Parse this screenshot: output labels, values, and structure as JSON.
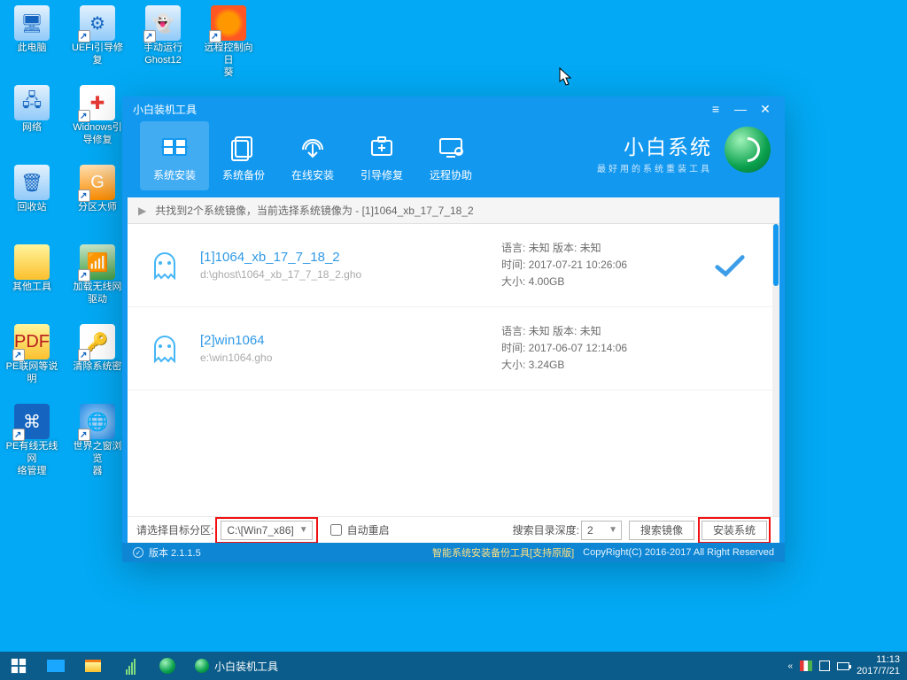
{
  "desktop": {
    "cols": [
      [
        {
          "id": "mycomputer",
          "label": "此电脑",
          "glyph": "mycomputer",
          "shortcut": false
        },
        {
          "id": "network",
          "label": "网络",
          "glyph": "network",
          "shortcut": false
        },
        {
          "id": "recyclebin",
          "label": "回收站",
          "glyph": "bin",
          "shortcut": false
        },
        {
          "id": "othertools",
          "label": "其他工具",
          "glyph": "folder",
          "shortcut": false
        },
        {
          "id": "pdfhelp",
          "label": "PE联网等说明",
          "glyph": "pdf",
          "shortcut": true
        },
        {
          "id": "lan",
          "label": "PE有线无线网\n络管理",
          "glyph": "lan",
          "shortcut": true
        }
      ],
      [
        {
          "id": "uefi",
          "label": "UEFI引导修复",
          "glyph": "uefi",
          "shortcut": true
        },
        {
          "id": "winboot",
          "label": "Widnows引\n导修复",
          "glyph": "firstaid",
          "shortcut": true
        },
        {
          "id": "diskmaster",
          "label": "分区大师",
          "glyph": "disk",
          "shortcut": true
        },
        {
          "id": "wifidriver",
          "label": "加载无线网\n驱动",
          "glyph": "antenna",
          "shortcut": true
        },
        {
          "id": "clearpwd",
          "label": "清除系统密",
          "glyph": "key",
          "shortcut": true
        },
        {
          "id": "browser",
          "label": "世界之窗浏览\n器",
          "glyph": "globe",
          "shortcut": true
        }
      ],
      [
        {
          "id": "ghost",
          "label": "手动运行\nGhost12",
          "glyph": "ghost",
          "shortcut": true
        }
      ],
      [
        {
          "id": "sunflower",
          "label": "远程控制向日\n葵",
          "glyph": "sunflower",
          "shortcut": true
        }
      ]
    ]
  },
  "window": {
    "title": "小白装机工具",
    "brand_primary": "小白系统",
    "brand_secondary": "最好用的系统重装工具",
    "tabs": [
      {
        "id": "install",
        "label": "系统安装",
        "active": true
      },
      {
        "id": "backup",
        "label": "系统备份",
        "active": false
      },
      {
        "id": "online",
        "label": "在线安装",
        "active": false
      },
      {
        "id": "bootfix",
        "label": "引导修复",
        "active": false
      },
      {
        "id": "remote",
        "label": "远程协助",
        "active": false
      }
    ],
    "infobar": "共找到2个系统镜像，当前选择系统镜像为 - [1]1064_xb_17_7_18_2",
    "items": [
      {
        "title": "[1]1064_xb_17_7_18_2",
        "path": "d:\\ghost\\1064_xb_17_7_18_2.gho",
        "lang": "语言: 未知    版本: 未知",
        "time": "时间: 2017-07-21 10:26:06",
        "size": "大小: 4.00GB",
        "selected": true
      },
      {
        "title": "[2]win1064",
        "path": "e:\\win1064.gho",
        "lang": "语言: 未知    版本: 未知",
        "time": "时间: 2017-06-07 12:14:06",
        "size": "大小: 3.24GB",
        "selected": false
      }
    ],
    "bottom": {
      "partition_label": "请选择目标分区:",
      "partition_value": "C:\\[Win7_x86]",
      "auto_reboot": "自动重启",
      "depth_label": "搜索目录深度:",
      "depth_value": "2",
      "search_btn": "搜索镜像",
      "install_btn": "安装系统"
    },
    "status": {
      "version_label": "版本 2.1.1.5",
      "product": "智能系统安装备份工具[支持原版]",
      "copyright": "CopyRight(C) 2016-2017 All Right Reserved"
    }
  },
  "taskbar": {
    "running_title": "小白装机工具",
    "time": "11:13",
    "date": "2017/7/21"
  }
}
